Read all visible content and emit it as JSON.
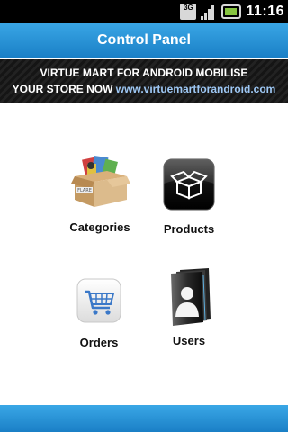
{
  "status_bar": {
    "network_label": "3G",
    "time": "11:16"
  },
  "header": {
    "title": "Control Panel"
  },
  "banner": {
    "line1": "VIRTUE MART FOR ANDROID MOBILISE",
    "line2_prefix": "YOUR STORE NOW",
    "line2_link": "www.virtuemartforandroid.com"
  },
  "menu": {
    "categories_label": "Categories",
    "products_label": "Products",
    "orders_label": "Orders",
    "users_label": "Users",
    "categories_box_text": "FLARE"
  },
  "icons": {
    "status": [
      "3g-icon",
      "signal-icon",
      "battery-icon"
    ],
    "menu": [
      "categories-box-icon",
      "products-box-icon",
      "shopping-cart-icon",
      "users-folder-icon"
    ]
  },
  "colors": {
    "header_blue": "#2a95d8",
    "banner_dark": "#1a1a1a",
    "link_blue": "#9ec8f5"
  }
}
